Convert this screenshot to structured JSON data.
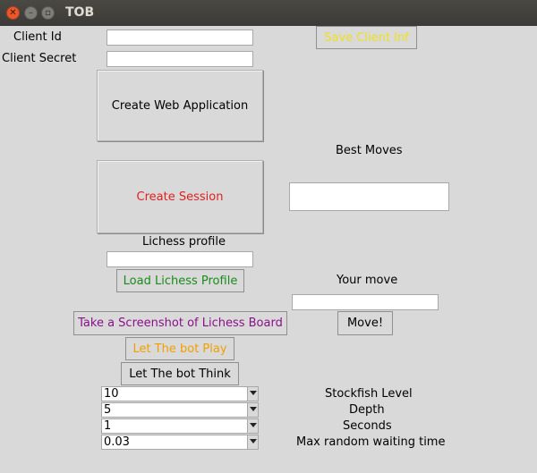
{
  "window": {
    "title": "TOB"
  },
  "client": {
    "id_label": "Client Id",
    "secret_label": "Client Secret",
    "id_value": "",
    "secret_value": "",
    "save_label": "Save Client Inf",
    "create_app_label": "Create Web Application",
    "create_session_label": "Create Session"
  },
  "profile": {
    "label": "Lichess profile",
    "value": "",
    "load_label": "Load Lichess Profile"
  },
  "moves": {
    "best_label": "Best Moves",
    "your_label": "Your move",
    "move_value": "",
    "move_button": "Move!"
  },
  "actions": {
    "screenshot_label": "Take a Screenshot of Lichess Board",
    "play_label": "Let The bot Play",
    "think_label": "Let The bot Think"
  },
  "settings": {
    "stockfish_level": "10",
    "depth": "5",
    "seconds": "1",
    "max_wait": "0.03",
    "stockfish_label": "Stockfish Level",
    "depth_label": "Depth",
    "seconds_label": "Seconds",
    "wait_label": "Max random waiting time"
  },
  "colors": {
    "save": "#f0e020",
    "session": "#e02020",
    "load": "#1a8a1a",
    "screenshot": "#8a108a",
    "play": "#f0a000"
  }
}
